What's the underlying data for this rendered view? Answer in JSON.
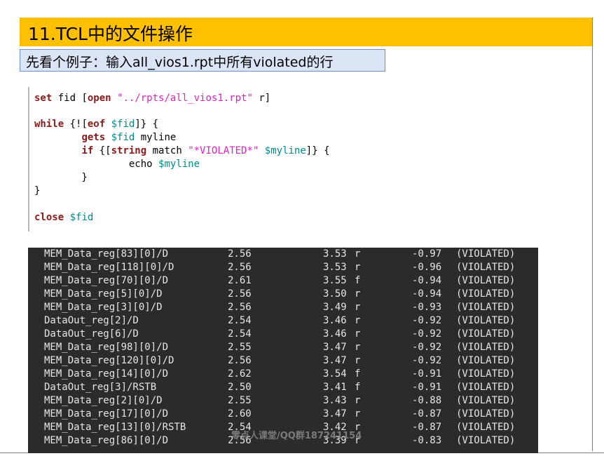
{
  "slide": {
    "title": "11.TCL中的文件操作",
    "subtitle": "先看个例子：输入all_vios1.rpt中所有violated的行"
  },
  "code": {
    "l1": {
      "kw1": "set",
      "t1": " fid [",
      "kw2": "open",
      "t2": " ",
      "str": "\"../rpts/all_vios1.rpt\"",
      "t3": " r]"
    },
    "l2": {
      "kw1": "while",
      "t1": " {![",
      "kw2": "eof",
      "t2": " ",
      "var": "$fid",
      "t3": "]} {"
    },
    "l3": {
      "indent": "        ",
      "kw": "gets",
      "t1": " ",
      "var": "$fid",
      "t2": " myline"
    },
    "l4": {
      "indent": "        ",
      "kw1": "if",
      "t1": " {[",
      "kw2": "string",
      "t2": " match ",
      "str": "\"*VIOLATED*\"",
      "t3": " ",
      "var": "$myline",
      "t4": "]} {"
    },
    "l5": {
      "indent": "                echo ",
      "var": "$myline"
    },
    "l6": {
      "text": "        }"
    },
    "l7": {
      "text": "}"
    },
    "l8": {
      "kw": "close",
      "t1": " ",
      "var": "$fid"
    }
  },
  "terminal": {
    "rows": [
      {
        "pin": "MEM_Data_reg[83][0]/D",
        "required": "2.56",
        "arrival": "3.53",
        "edge": "r",
        "slack": "-0.97",
        "status": "(VIOLATED)"
      },
      {
        "pin": "MEM_Data_reg[118][0]/D",
        "required": "2.56",
        "arrival": "3.53",
        "edge": "r",
        "slack": "-0.96",
        "status": "(VIOLATED)"
      },
      {
        "pin": "MEM_Data_reg[70][0]/D",
        "required": "2.61",
        "arrival": "3.55",
        "edge": "f",
        "slack": "-0.94",
        "status": "(VIOLATED)"
      },
      {
        "pin": "MEM_Data_reg[5][0]/D",
        "required": "2.56",
        "arrival": "3.50",
        "edge": "r",
        "slack": "-0.94",
        "status": "(VIOLATED)"
      },
      {
        "pin": "MEM_Data_reg[3][0]/D",
        "required": "2.56",
        "arrival": "3.49",
        "edge": "r",
        "slack": "-0.93",
        "status": "(VIOLATED)"
      },
      {
        "pin": "DataOut_reg[2]/D",
        "required": "2.54",
        "arrival": "3.46",
        "edge": "r",
        "slack": "-0.92",
        "status": "(VIOLATED)"
      },
      {
        "pin": "DataOut_reg[6]/D",
        "required": "2.54",
        "arrival": "3.46",
        "edge": "r",
        "slack": "-0.92",
        "status": "(VIOLATED)"
      },
      {
        "pin": "MEM_Data_reg[98][0]/D",
        "required": "2.55",
        "arrival": "3.47",
        "edge": "r",
        "slack": "-0.92",
        "status": "(VIOLATED)"
      },
      {
        "pin": "MEM_Data_reg[120][0]/D",
        "required": "2.56",
        "arrival": "3.47",
        "edge": "r",
        "slack": "-0.92",
        "status": "(VIOLATED)"
      },
      {
        "pin": "MEM_Data_reg[14][0]/D",
        "required": "2.62",
        "arrival": "3.54",
        "edge": "f",
        "slack": "-0.91",
        "status": "(VIOLATED)"
      },
      {
        "pin": "DataOut_reg[3]/RSTB",
        "required": "2.50",
        "arrival": "3.41",
        "edge": "f",
        "slack": "-0.91",
        "status": "(VIOLATED)"
      },
      {
        "pin": "MEM_Data_reg[2][0]/D",
        "required": "2.55",
        "arrival": "3.43",
        "edge": "r",
        "slack": "-0.88",
        "status": "(VIOLATED)"
      },
      {
        "pin": "MEM_Data_reg[17][0]/D",
        "required": "2.60",
        "arrival": "3.47",
        "edge": "r",
        "slack": "-0.87",
        "status": "(VIOLATED)"
      },
      {
        "pin": "MEM_Data_reg[13][0]/RSTB",
        "required": "2.54",
        "arrival": "3.42",
        "edge": "r",
        "slack": "-0.87",
        "status": "(VIOLATED)"
      },
      {
        "pin": "MEM_Data_reg[86][0]/D",
        "required": "2.56",
        "arrival": "3.39",
        "edge": "r",
        "slack": "-0.83",
        "status": "(VIOLATED)"
      }
    ]
  },
  "watermark": "零点人课堂/QQ群187241154",
  "colors": {
    "title_bg": "#ffc000",
    "subtitle_bg": "#dbe5f5",
    "keyword": "#8b1a1a",
    "string": "#e020c0",
    "variable": "#008b8b",
    "terminal_bg": "#2b2b2b",
    "terminal_fg": "#e6e6e6"
  }
}
